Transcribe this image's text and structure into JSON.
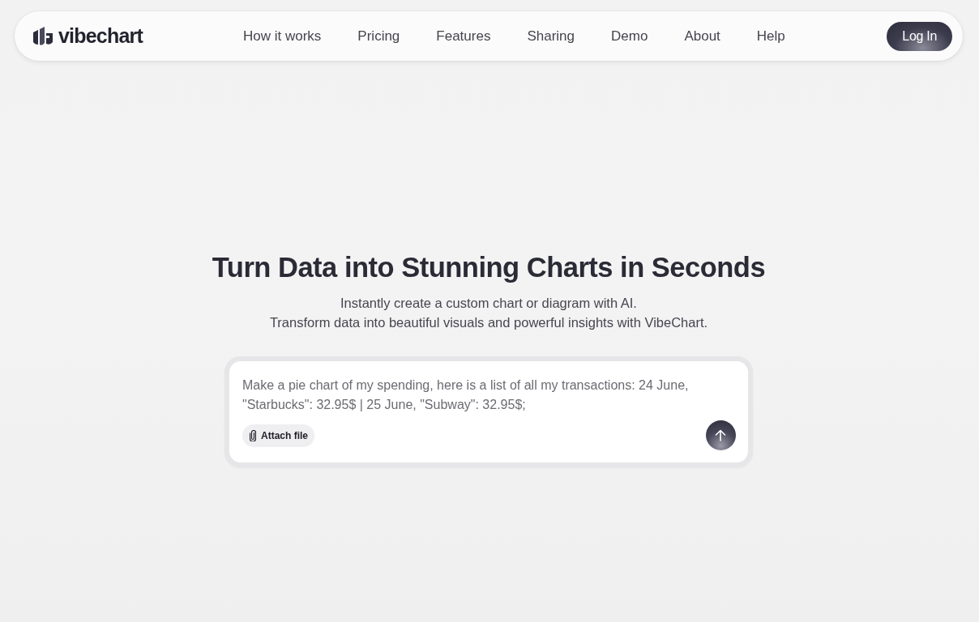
{
  "nav": {
    "logo": "vibechart",
    "links": [
      "How it works",
      "Pricing",
      "Features",
      "Sharing",
      "Demo",
      "About",
      "Help"
    ],
    "login": "Log In"
  },
  "hero": {
    "title": "Turn Data into Stunning Charts in Seconds",
    "subtitle_lines": [
      "Instantly create a custom chart or diagram with AI.",
      "Transform data into beautiful visuals and powerful insights with VibeChart."
    ]
  },
  "prompt": {
    "placeholder": "Make a pie chart of my spending, here is a list of all my transactions: 24 June, \"Starbucks\": 32.95$ | 25 June, \"Subway\": 32.95$;",
    "attach_label": "Attach file"
  }
}
